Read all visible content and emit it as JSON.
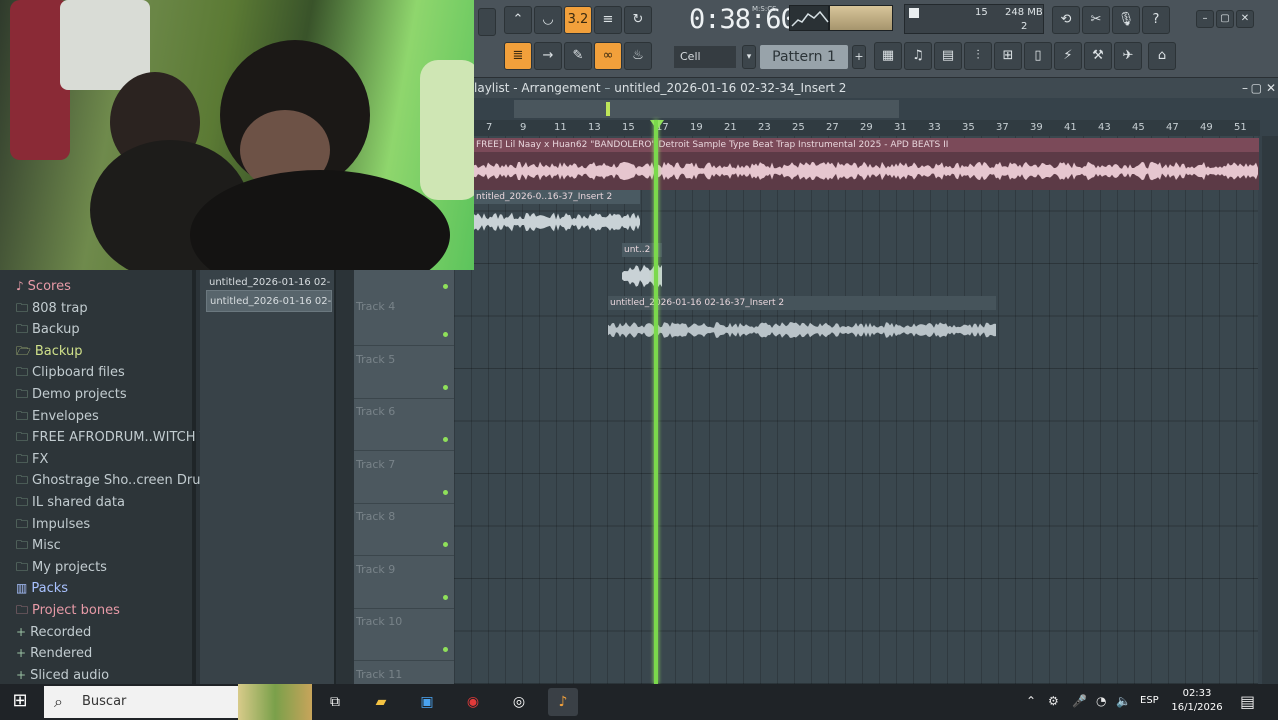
{
  "window": {
    "title": "laylist - Arrangement",
    "project": "untitled_2026-01-16 02-32-34_Insert 2"
  },
  "toolbar": {
    "time": "0:38:60",
    "time_unit": "M:S:CS",
    "cpu_num": "15",
    "ram": "248 MB",
    "poly": "2",
    "snap": "Cell",
    "pattern": "Pattern 1",
    "tempo_label": "3.2"
  },
  "browser": {
    "items": [
      {
        "label": "Scores",
        "icon": "music-note-icon",
        "accent": "#e79aa7"
      },
      {
        "label": "808 trap",
        "icon": "folder-icon"
      },
      {
        "label": "Backup",
        "icon": "folder-icon"
      },
      {
        "label": "Backup",
        "icon": "folder-open-icon",
        "accent": "#cfe08a"
      },
      {
        "label": "Clipboard files",
        "icon": "folder-icon"
      },
      {
        "label": "Demo projects",
        "icon": "folder-icon"
      },
      {
        "label": "Envelopes",
        "icon": "folder-icon"
      },
      {
        "label": "FREE AFRODRUM..WITCH VIBEZ",
        "icon": "folder-icon"
      },
      {
        "label": "FX",
        "icon": "folder-icon"
      },
      {
        "label": "Ghostrage Sho..creen Drum Kit",
        "icon": "folder-icon"
      },
      {
        "label": "IL shared data",
        "icon": "folder-icon"
      },
      {
        "label": "Impulses",
        "icon": "folder-icon"
      },
      {
        "label": "Misc",
        "icon": "folder-icon"
      },
      {
        "label": "My projects",
        "icon": "folder-icon"
      },
      {
        "label": "Packs",
        "icon": "packs-icon",
        "accent": "#a9c2ff"
      },
      {
        "label": "Project bones",
        "icon": "folder-icon",
        "accent": "#e79aa7"
      },
      {
        "label": "Recorded",
        "icon": "plus-icon"
      },
      {
        "label": "Rendered",
        "icon": "plus-icon"
      },
      {
        "label": "Sliced audio",
        "icon": "plus-icon"
      }
    ]
  },
  "clips_panel": {
    "items": [
      "untitled_2026-01-16 02-",
      "untitled_2026-01-16 02-"
    ]
  },
  "ruler": [
    "7",
    "9",
    "11",
    "13",
    "15",
    "17",
    "19",
    "21",
    "23",
    "25",
    "27",
    "29",
    "31",
    "33",
    "35",
    "37",
    "39",
    "41",
    "43",
    "45",
    "47",
    "49",
    "51"
  ],
  "tracks": [
    "Track 4",
    "Track 5",
    "Track 6",
    "Track 7",
    "Track 8",
    "Track 9",
    "Track 10",
    "Track 11"
  ],
  "clips": {
    "clip1": "FREE] Lil Naay x Huan62 \"BANDOLERO\" Detroit Sample Type Beat  Trap Instrumental 2025 - APD BEATS II",
    "clip2": "ntitled_2026-0..16-37_Insert 2",
    "clip3": "unt..2",
    "clip4": "untitled_2026-01-16 02-16-37_Insert 2"
  },
  "taskbar": {
    "search": "Buscar",
    "lang": "ESP",
    "time": "02:33",
    "date": "16/1/2026"
  },
  "colors": {
    "accent": "#f2a03b",
    "playhead": "#7bd94c",
    "clip_wave": "#e6c6cf"
  }
}
